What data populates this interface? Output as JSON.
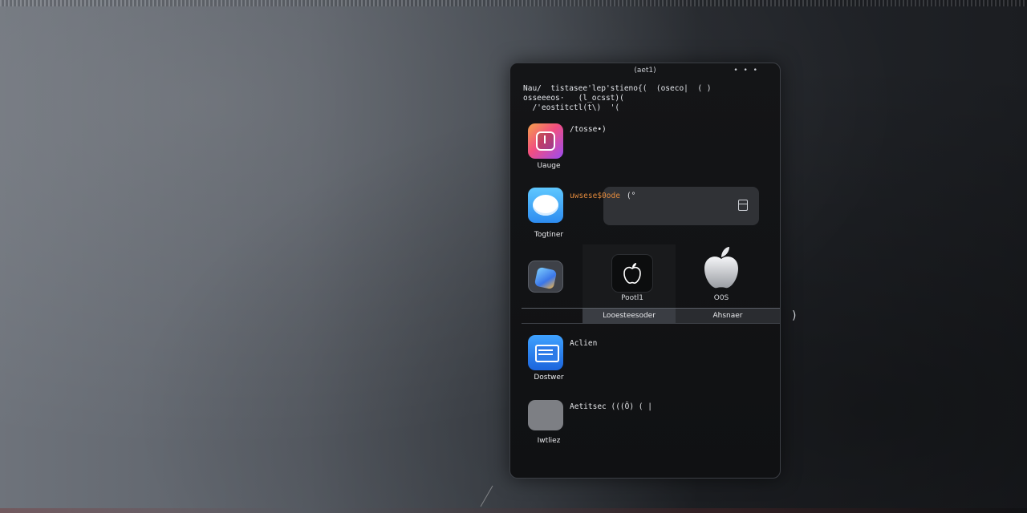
{
  "phone": {
    "status_title": "(aet1)",
    "status_dots": "• • •",
    "code_lines": [
      "Nau/  tistasee'lep'stieno{(  (oseco|  ( )",
      "osseeeos·   (l_ocsst)(",
      "  /'eostitctl(t\\)  '("
    ]
  },
  "apps": [
    {
      "label": "Uauge",
      "side_text": "/tosse•)"
    },
    {
      "label": "Togtiner",
      "side_text": ""
    },
    {
      "label": "",
      "side_text": ""
    },
    {
      "label": "Dostwer",
      "side_text": "Aclien"
    },
    {
      "label": "Iwtliez",
      "side_text": "Aetitsec   (((Ö)           ( |"
    }
  ],
  "notification": {
    "orange_text": "uwsese$0ode",
    "suffix": "(°"
  },
  "icons": {
    "apple_small_label": "Pootl1",
    "apple_big_label": "O0S"
  },
  "tabs": {
    "left": "Looesteesoder",
    "right": "Ahsnaer"
  },
  "side_bracket": ")"
}
